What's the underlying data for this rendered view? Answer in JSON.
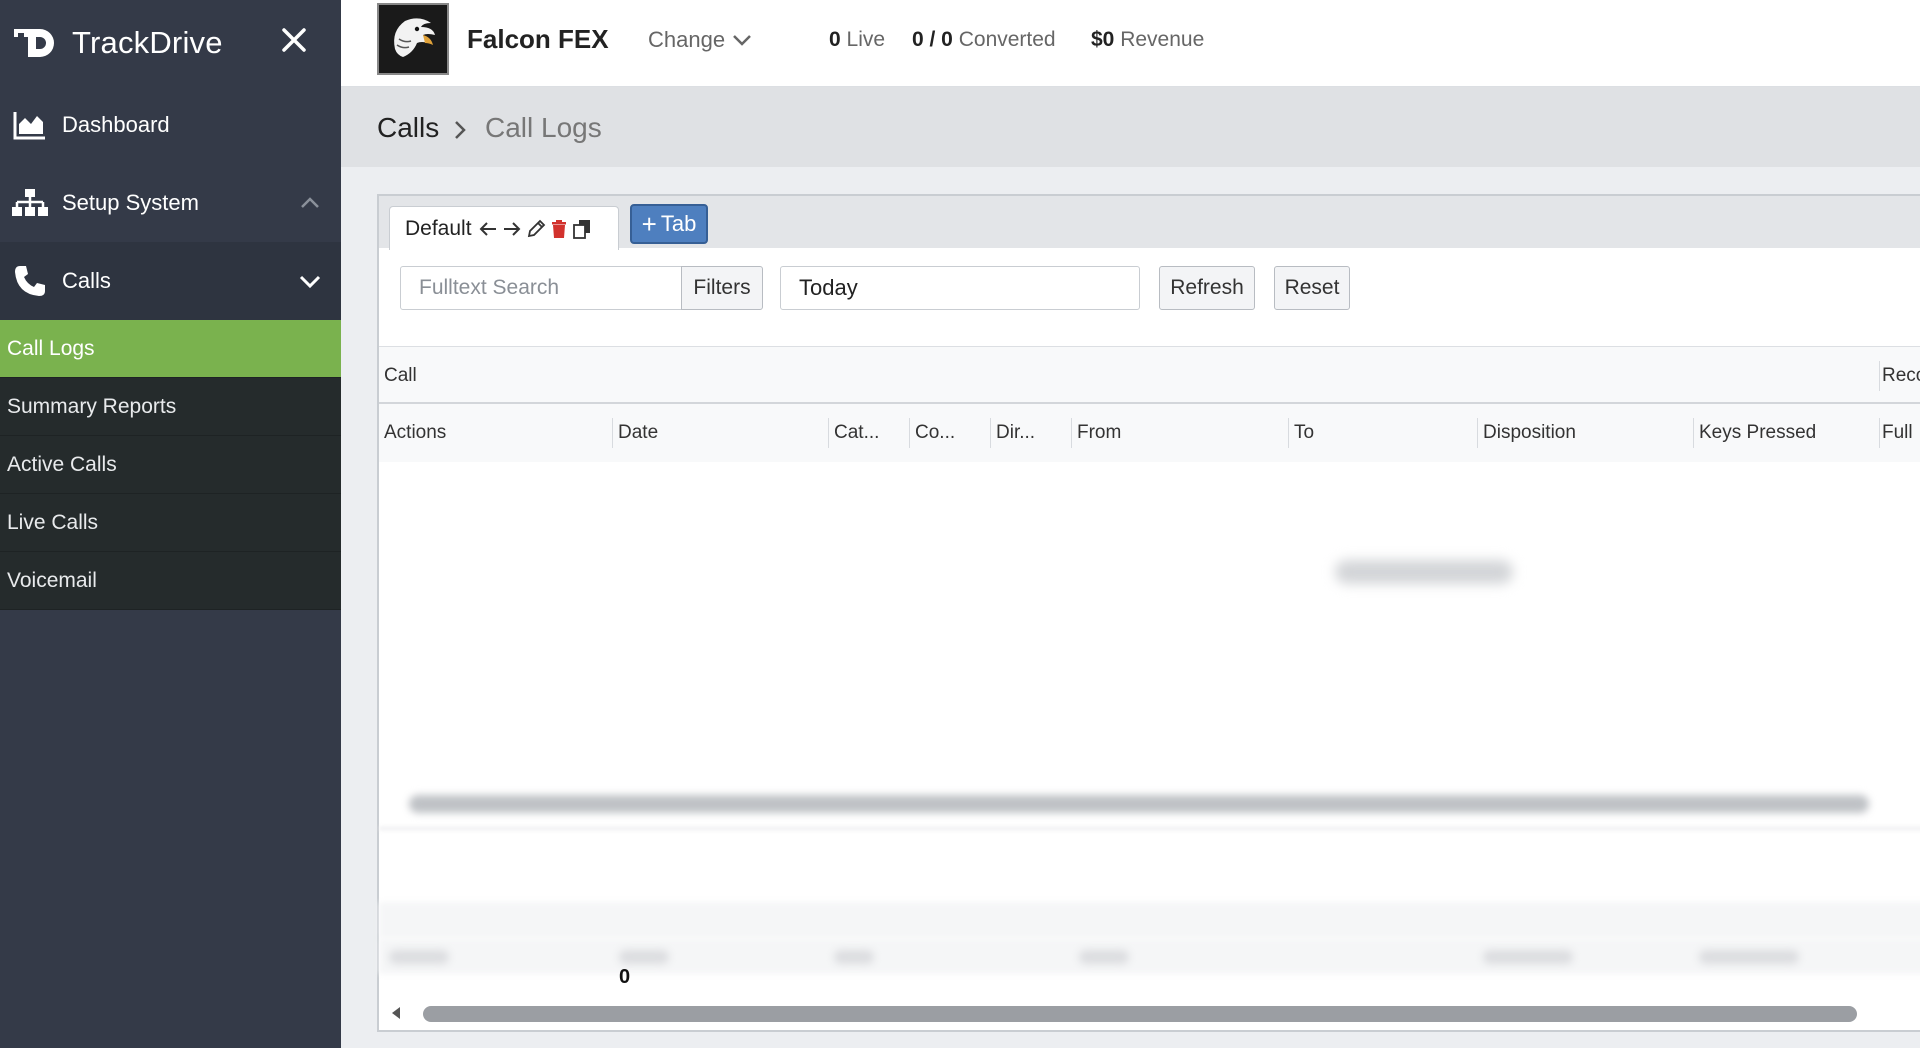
{
  "sidebar": {
    "brand": "TrackDrive",
    "items": [
      {
        "label": "Dashboard",
        "icon": "chart-icon"
      },
      {
        "label": "Setup System",
        "icon": "sitemap-icon"
      },
      {
        "label": "Calls",
        "icon": "phone-icon"
      }
    ],
    "subitems": [
      {
        "label": "Call Logs",
        "active": true
      },
      {
        "label": "Summary Reports"
      },
      {
        "label": "Active Calls"
      },
      {
        "label": "Live Calls"
      },
      {
        "label": "Voicemail"
      }
    ]
  },
  "topbar": {
    "company_name": "Falcon FEX",
    "change_label": "Change",
    "live_count": "0",
    "live_label": "Live",
    "converted_count": "0 / 0",
    "converted_label": "Converted",
    "revenue_value": "$0",
    "revenue_label": "Revenue"
  },
  "breadcrumb": {
    "parent": "Calls",
    "current": "Call Logs"
  },
  "tabs": {
    "default_label": "Default",
    "add_label": "Tab"
  },
  "filters": {
    "search_placeholder": "Fulltext Search",
    "filters_label": "Filters",
    "date_value": "Today",
    "refresh_label": "Refresh",
    "reset_label": "Reset"
  },
  "grid": {
    "group_left": "Call",
    "group_right": "Reco",
    "columns": [
      "Actions",
      "Date",
      "Cat...",
      "Co...",
      "Dir...",
      "From",
      "To",
      "Disposition",
      "Keys Pressed",
      "Full"
    ],
    "total": "0"
  },
  "colors": {
    "sidebar": "#343a48",
    "active_green": "#7ab24e",
    "tab_blue": "#4e7fbf"
  }
}
